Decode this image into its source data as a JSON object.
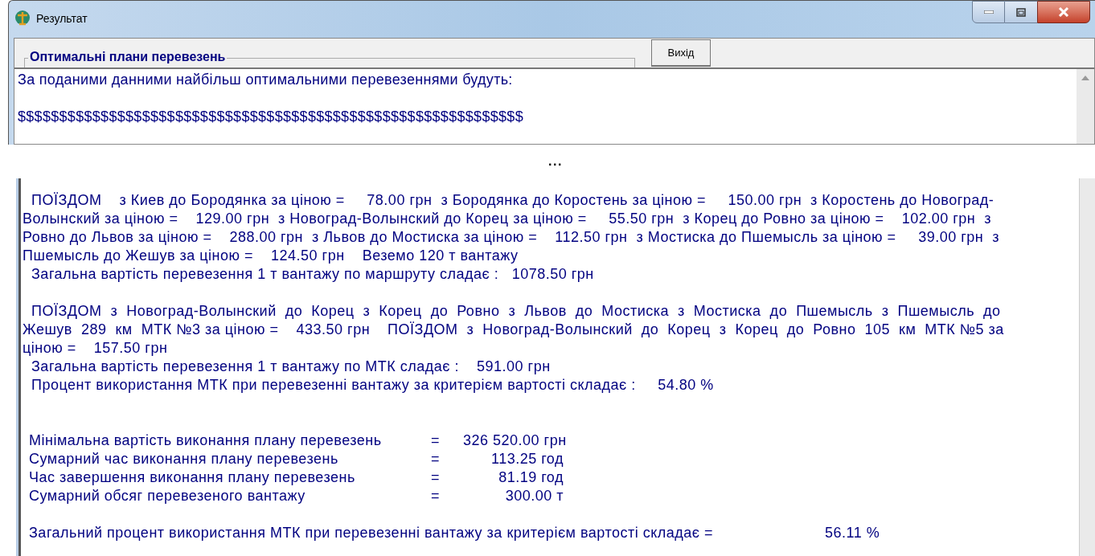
{
  "window": {
    "title": "Результат"
  },
  "group_box": {
    "title": "Оптимальні плани перевезень"
  },
  "exit_button": {
    "label": "Вихід"
  },
  "output_top": [
    {
      "kind": "text",
      "text": "За поданими данними найбільш оптимальними перевезеннями будуть:"
    },
    {
      "kind": "blank"
    },
    {
      "kind": "text",
      "text": "$$$$$$$$$$$$$$$$$$$$$$$$$$$$$$$$$$$$$$$$$$$$$$$$$$$$$$$$$$$$$"
    }
  ],
  "gap_marker": "...",
  "output_bottom": [
    {
      "kind": "text",
      "text": "  ПОЇЗДОМ    з Киев до Бородянка за ціною =     78.00 грн  з Бородянка до Коростень за ціною =     150.00 грн  з Коростень до Новоград-"
    },
    {
      "kind": "text",
      "text": "Волынский за ціною =    129.00 грн  з Новоград-Волынский до Корец за ціною =     55.50 грн  з Корец до Ровно за ціною =    102.00 грн  з"
    },
    {
      "kind": "text",
      "text": "Ровно до Львов за ціною =    288.00 грн  з Львов до Мостиска за ціною =    112.50 грн  з Мостиска до Пшемысль за ціною =     39.00 грн  з"
    },
    {
      "kind": "text",
      "text": "Пшемысль до Жешув за ціною =    124.50 грн    Веземо 120 т вантажу"
    },
    {
      "kind": "text",
      "text": "  Загальна вартість перевезення 1 т вантажу по маршруту сладає :   1078.50 грн"
    },
    {
      "kind": "blank"
    },
    {
      "kind": "text",
      "text": "  ПОЇЗДОМ  з  Новоград-Волынский  до  Корец  з  Корец  до  Ровно  з  Львов  до  Мостиска  з  Мостиска  до  Пшемысль  з  Пшемысль  до"
    },
    {
      "kind": "text",
      "text": "Жешув  289  км  МТК №3 за ціною =    433.50 грн    ПОЇЗДОМ  з  Новоград-Волынский  до  Корец  з  Корец  до  Ровно  105  км  МТК №5 за"
    },
    {
      "kind": "text",
      "text": "ціною =    157.50 грн"
    },
    {
      "kind": "text",
      "text": "  Загальна вартість перевезення 1 т вантажу по МТК сладає :    591.00 грн"
    },
    {
      "kind": "text",
      "text": "  Процент використання МТК при перевезенні вантажу за критерієм вартості складає :     54.80 %"
    },
    {
      "kind": "blank"
    },
    {
      "kind": "blank"
    },
    {
      "kind": "stat",
      "label": "Мінімальна вартість виконання плану перевезень",
      "sign": "=",
      "value": "326 520.00 грн"
    },
    {
      "kind": "stat",
      "label": "Сумарний час виконання плану перевезень",
      "sign": "=",
      "value": "113.25 год"
    },
    {
      "kind": "stat",
      "label": "Час завершення виконання плану перевезень",
      "sign": "=",
      "value": "81.19 год"
    },
    {
      "kind": "stat",
      "label": "Сумарний обсяг перевезеного вантажу",
      "sign": "=",
      "value": "300.00 т"
    },
    {
      "kind": "blank"
    },
    {
      "kind": "total",
      "label": "Загальний процент використання МТК при перевезенні вантажу за критерієм вартості складає =",
      "value": "56.11 %"
    }
  ]
}
